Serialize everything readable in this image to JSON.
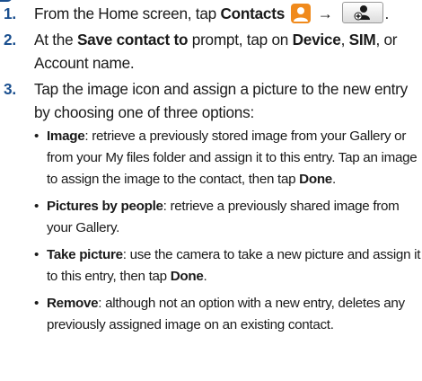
{
  "steps": [
    {
      "num": "1",
      "pre": "From the Home screen, tap ",
      "bold": "Contacts",
      "end": "."
    },
    {
      "num": "2",
      "pre": "At the ",
      "b1": "Save contact to",
      "mid1": " prompt, tap on ",
      "b2": "Device",
      "mid2": ", ",
      "b3": "SIM",
      "post": ", or Account name."
    },
    {
      "num": "3",
      "text": "Tap the image icon and assign a picture to the new entry by choosing one of three options:"
    }
  ],
  "bullets": [
    {
      "label": "Image",
      "text": ": retrieve a previously stored image from your Gallery or from your My files folder and assign it to this entry. Tap an image to assign the image to the contact, then tap ",
      "bold_end": "Done",
      "end": "."
    },
    {
      "label": "Pictures by people",
      "text": ": retrieve a previously shared image from your Gallery.",
      "bold_end": "",
      "end": ""
    },
    {
      "label": "Take picture",
      "text": ": use the camera to take a new picture and assign it to this entry, then tap ",
      "bold_end": "Done",
      "end": "."
    },
    {
      "label": "Remove",
      "text": ": although not an option with a new entry, deletes any previously assigned image on an existing contact.",
      "bold_end": "",
      "end": ""
    }
  ],
  "symbols": {
    "arrow": "→",
    "bullet": "•"
  },
  "icons": {
    "contacts": "contacts-app-icon",
    "add_contact": "add-contact-icon"
  },
  "colors": {
    "step_number": "#1a4f8f",
    "contacts_icon": "#f08a1c"
  }
}
